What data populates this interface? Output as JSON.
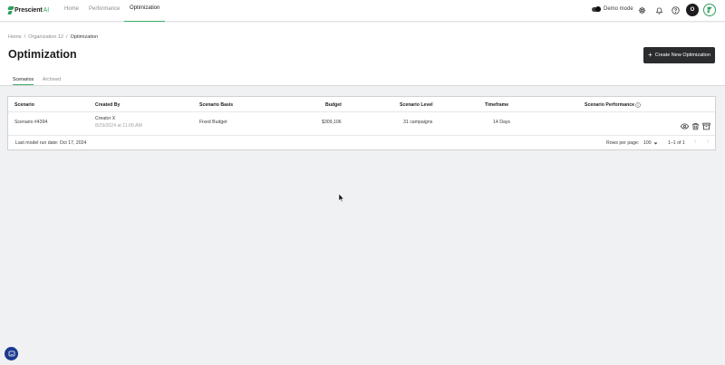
{
  "brand": {
    "name": "Prescient",
    "suffix": "AI"
  },
  "nav": {
    "tabs": [
      {
        "label": "Home"
      },
      {
        "label": "Performance"
      },
      {
        "label": "Optimization"
      }
    ]
  },
  "topbar": {
    "demo_mode_label": "Demo mode",
    "avatar_initial": "O"
  },
  "breadcrumb": {
    "items": [
      "Home",
      "Organization 12",
      "Optimization"
    ],
    "separator": "/"
  },
  "page": {
    "title": "Optimization",
    "create_button": "Create New Optimization"
  },
  "subtabs": [
    {
      "label": "Scenarios"
    },
    {
      "label": "Archived"
    }
  ],
  "table": {
    "headers": [
      "Scenario",
      "Created By",
      "Scenario Basis",
      "Budget",
      "Scenario Level",
      "Timeframe",
      "Scenario Performance"
    ],
    "rows": [
      {
        "scenario": "Scenario #4394",
        "created_by": "Creator X",
        "created_at": "8/29/2024 at 11:00 AM",
        "basis": "Fixed Budget",
        "budget": "$309,106",
        "level": "31 campaigns",
        "timeframe": "14 Days"
      }
    ],
    "footer": {
      "last_run": "Last model run date: Oct 17, 2024",
      "rows_per_page_label": "Rows per page:",
      "rows_per_page_value": "100",
      "range": "1–1 of 1"
    }
  },
  "colors": {
    "accent": "#3fae6a",
    "dark_button": "#2b2c2e",
    "chat_fab": "#1b3a8f"
  }
}
